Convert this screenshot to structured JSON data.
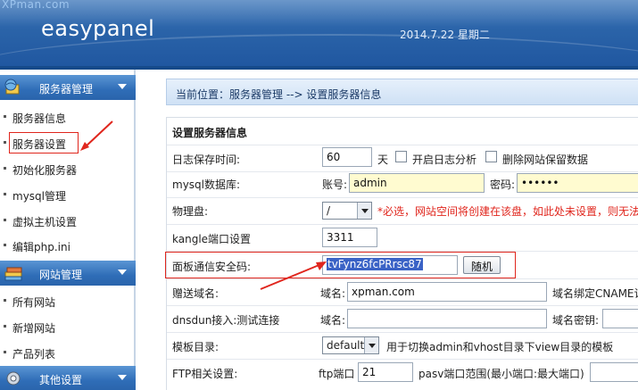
{
  "header": {
    "watermark": "XPman.com",
    "logo": "easypanel",
    "date": "2014.7.22 星期二"
  },
  "sidebar": {
    "groups": [
      {
        "title": "服务器管理",
        "icon": "server-globe-icon"
      },
      {
        "title": "网站管理",
        "icon": "books-icon"
      },
      {
        "title": "其他设置",
        "icon": "tools-icon"
      }
    ],
    "items": [
      {
        "label": "服务器信息"
      },
      {
        "label": "服务器设置"
      },
      {
        "label": "初始化服务器"
      },
      {
        "label": "mysql管理"
      },
      {
        "label": "虚拟主机设置"
      },
      {
        "label": "编辑php.ini"
      },
      {
        "label": "所有网站"
      },
      {
        "label": "新增网站"
      },
      {
        "label": "产品列表"
      }
    ]
  },
  "breadcrumb": "当前位置：服务器管理 --> 设置服务器信息",
  "form": {
    "section_title": "设置服务器信息",
    "log_days": {
      "label": "日志保存时间:",
      "value": "60",
      "unit": "天",
      "cb1": "开启日志分析",
      "cb2": "删除网站保留数据"
    },
    "mysql": {
      "label": "mysql数据库:",
      "user_label": "账号:",
      "user_value": "admin",
      "pwd_label": "密码:",
      "pwd_value": "••••••"
    },
    "disk": {
      "label": "物理盘:",
      "value": "/",
      "warning": "*必选，网站空间将创建在该盘，如此处未设置，则无法"
    },
    "kangle_port": {
      "label": "kangle端口设置",
      "value": "3311"
    },
    "panel_key": {
      "label": "面板通信安全码:",
      "value": "tvFynz6fcPRrsc87",
      "button": "随机"
    },
    "gift_domain": {
      "label": "赠送域名:",
      "domain_label": "域名:",
      "domain_value": "xpman.com",
      "cname_label": "域名绑定CNAME记"
    },
    "dnsdun": {
      "label": "dnsdun接入:测试连接",
      "domain_label": "域名:",
      "key_label": "域名密钥:"
    },
    "template": {
      "label": "模板目录:",
      "value": "default",
      "hint": "用于切换admin和vhost目录下view目录的模板"
    },
    "ftp": {
      "label": "FTP相关设置:",
      "port_label": "ftp端口",
      "port_value": "21",
      "pasv_label": "pasv端口范围(最小端口:最大端口)"
    }
  },
  "colors": {
    "header_blue": "#2a63a8",
    "annotation_red": "#e0261d",
    "input_yellow": "#fffbd0"
  }
}
